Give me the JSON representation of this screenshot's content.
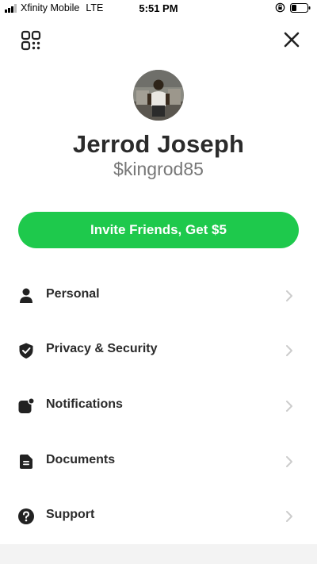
{
  "status_bar": {
    "carrier": "Xfinity Mobile",
    "network": "LTE",
    "time": "5:51 PM"
  },
  "profile": {
    "name": "Jerrod Joseph",
    "cashtag": "$kingrod85"
  },
  "invite_button": {
    "label": "Invite Friends, Get $5"
  },
  "menu": {
    "items": [
      {
        "label": "Personal",
        "icon": "person-icon"
      },
      {
        "label": "Privacy & Security",
        "icon": "shield-icon"
      },
      {
        "label": "Notifications",
        "icon": "notification-icon"
      },
      {
        "label": "Documents",
        "icon": "document-icon"
      },
      {
        "label": "Support",
        "icon": "question-icon"
      }
    ]
  },
  "colors": {
    "accent": "#1ec94c",
    "text": "#2b2b2b",
    "secondary_text": "#777777",
    "chevron": "#cccccc"
  }
}
